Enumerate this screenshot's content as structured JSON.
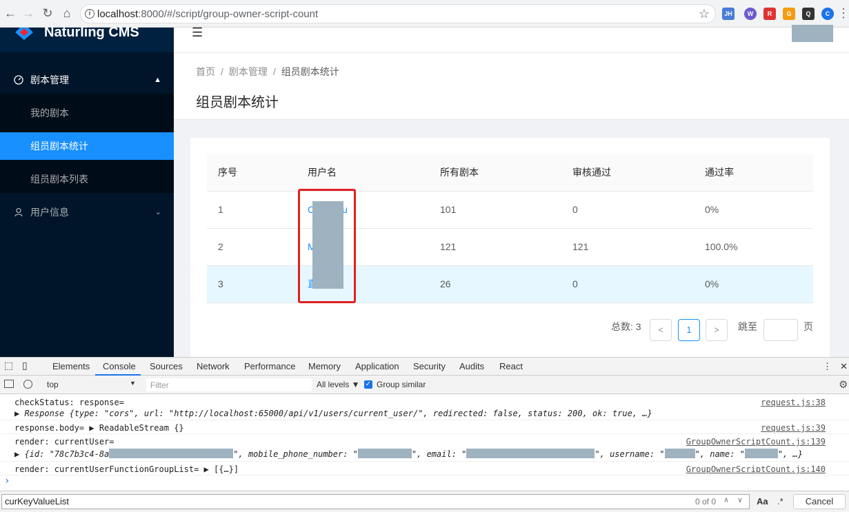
{
  "browser": {
    "url_host": "localhost",
    "url_rest": ":8000/#/script/group-owner-script-count",
    "extensions": [
      "JH",
      "W",
      "R",
      "G",
      "Q",
      "C"
    ]
  },
  "app": {
    "name": "Naturling CMS"
  },
  "sidebar": {
    "items": [
      {
        "label": "剧本管理",
        "icon": "dashboard-icon"
      },
      {
        "label": "我的剧本"
      },
      {
        "label": "组员剧本统计"
      },
      {
        "label": "组员剧本列表"
      },
      {
        "label": "用户信息",
        "icon": "user-icon"
      }
    ]
  },
  "breadcrumb": {
    "home": "首页",
    "section": "剧本管理",
    "current": "组员剧本统计",
    "sep": "/"
  },
  "page_title": "组员剧本统计",
  "table": {
    "columns": [
      "序号",
      "用户名",
      "所有剧本",
      "审核通过",
      "通过率"
    ],
    "rows": [
      {
        "no": "1",
        "user": "C",
        "user_tail": "u",
        "total": "101",
        "passed": "0",
        "rate": "0%"
      },
      {
        "no": "2",
        "user": "M",
        "user_tail": "",
        "total": "121",
        "passed": "121",
        "rate": "100.0%"
      },
      {
        "no": "3",
        "user": "直",
        "user_tail": "",
        "total": "26",
        "passed": "0",
        "rate": "0%"
      }
    ]
  },
  "pagination": {
    "total_label": "总数:",
    "total": "3",
    "prev": "<",
    "page": "1",
    "next": ">",
    "jump_label": "跳至",
    "page_unit": "页"
  },
  "devtools": {
    "tabs": [
      "Elements",
      "Console",
      "Sources",
      "Network",
      "Performance",
      "Memory",
      "Application",
      "Security",
      "Audits",
      "React"
    ],
    "context": "top",
    "filter_placeholder": "Filter",
    "levels": "All levels ▼",
    "group_similar": "Group similar",
    "logs": [
      {
        "text": "checkStatus: response=",
        "src": "request.js:38"
      },
      {
        "text": "▶ Response {type: \"cors\", url: \"http://localhost:65000/api/v1/users/current_user/\", redirected: false, status: 200, ok: true, …}",
        "src": ""
      },
      {
        "text": "response.body= ▶ ReadableStream {}",
        "src": "request.js:39"
      },
      {
        "text": "render: currentUser=",
        "src": "GroupOwnerScriptCount.js:139"
      },
      {
        "text": "▶ {id: \"78c7b3c4-8a",
        "src": ""
      },
      {
        "text": "render: currentUserFunctionGroupList= ▶ [{…}]",
        "src": "GroupOwnerScriptCount.js:140"
      }
    ],
    "currentuser_fields": {
      "mobile": "\", mobile_phone_number: \"",
      "email": "\", email: \"",
      "username": "\", username: \"",
      "name": "\", name: \"",
      "end": "\", …}"
    },
    "prompt": "›",
    "find_value": "curKeyValueList",
    "find_count": "0 of 0",
    "aa": "Aa",
    "regex": ".*",
    "cancel": "Cancel"
  }
}
